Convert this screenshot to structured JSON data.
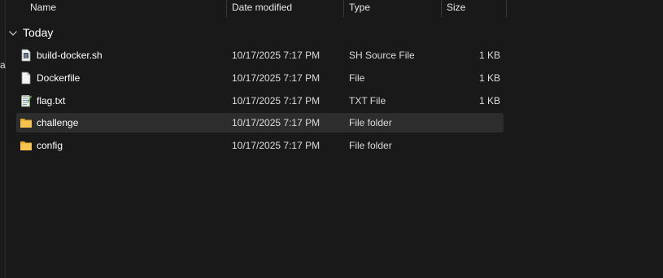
{
  "columns": {
    "name": "Name",
    "date_modified": "Date modified",
    "type": "Type",
    "size": "Size"
  },
  "group": {
    "label": "Today",
    "expanded": true
  },
  "files": [
    {
      "name": "build-docker.sh",
      "date": "10/17/2025 7:17 PM",
      "type": "SH Source File",
      "size": "1 KB",
      "icon": "script-file-icon"
    },
    {
      "name": "Dockerfile",
      "date": "10/17/2025 7:17 PM",
      "type": "File",
      "size": "1 KB",
      "icon": "file-icon"
    },
    {
      "name": "flag.txt",
      "date": "10/17/2025 7:17 PM",
      "type": "TXT File",
      "size": "1 KB",
      "icon": "text-file-icon"
    },
    {
      "name": "challenge",
      "date": "10/17/2025 7:17 PM",
      "type": "File folder",
      "size": "",
      "icon": "folder-icon",
      "selected": true
    },
    {
      "name": "config",
      "date": "10/17/2025 7:17 PM",
      "type": "File folder",
      "size": "",
      "icon": "folder-icon"
    }
  ],
  "edge_glyph": "a",
  "colors": {
    "background": "#191919",
    "selected_row": "#2d2d2d",
    "folder": "#f3c04e"
  }
}
